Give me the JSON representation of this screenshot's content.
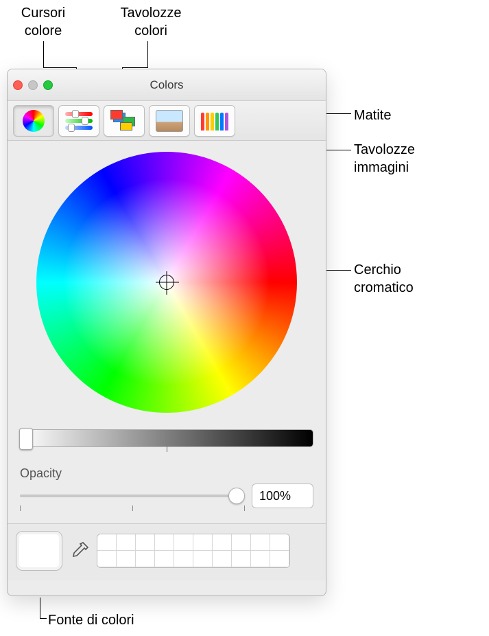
{
  "window": {
    "title": "Colors"
  },
  "tabs": {
    "wheel": "color-wheel",
    "sliders": "color-sliders",
    "palettes": "color-palettes",
    "image": "image-palettes",
    "pencils": "pencils"
  },
  "opacity": {
    "label": "Opacity",
    "value": "100%"
  },
  "callouts": {
    "sliders": "Cursori\ncolore",
    "palettes": "Tavolozze\ncolori",
    "pencils": "Matite",
    "image": "Tavolozze\nimmagini",
    "wheel": "Cerchio\ncromatico",
    "well": "Fonte di colori"
  },
  "colors": {
    "red": "#ff0000",
    "green": "#14d300",
    "blue": "#0070ff",
    "yellow": "#ffd500",
    "cyan": "#00d5ff",
    "magenta": "#ff00d8",
    "brown": "#8b5a2b"
  }
}
